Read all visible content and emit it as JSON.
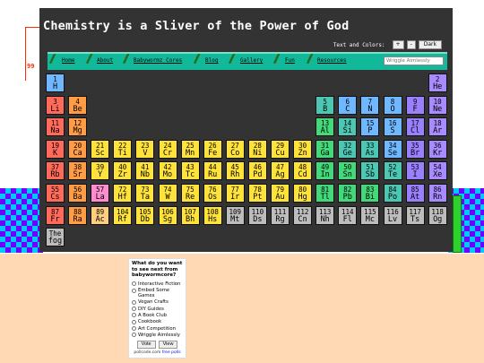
{
  "header": {
    "title": "Chemistry is a Sliver of the Power of God"
  },
  "controls": {
    "label": "Text and Colors:",
    "plus": "+",
    "minus": "-",
    "dark": "Dark"
  },
  "nav": {
    "items": [
      "Home",
      "About",
      "Babywormz Cores",
      "Blog",
      "Gallery",
      "Fun",
      "Resources"
    ],
    "search_placeholder": "Wriggle Aimlessly"
  },
  "decor": {
    "side_text": "99"
  },
  "colors": {
    "nonmetal": "#6fb7ff",
    "noble": "#a78bff",
    "alkali": "#ff6a5a",
    "alkaline": "#ff9c44",
    "transition": "#ffe23a",
    "post_transition": "#43d87a",
    "metalloid": "#4cc7b3",
    "halogen": "#9a80ff",
    "lanthanide": "#ff8ccf",
    "actinide": "#ffcf7f",
    "unknown": "#bdbdbd"
  },
  "elements": [
    {
      "n": "1",
      "s": "H",
      "c": "nonmetal",
      "r": 0,
      "col": 0
    },
    {
      "n": "2",
      "s": "He",
      "c": "noble",
      "r": 0,
      "col": 17
    },
    {
      "n": "3",
      "s": "Li",
      "c": "alkali",
      "r": 1,
      "col": 0
    },
    {
      "n": "4",
      "s": "Be",
      "c": "alkaline",
      "r": 1,
      "col": 1
    },
    {
      "n": "5",
      "s": "B",
      "c": "metalloid",
      "r": 1,
      "col": 12
    },
    {
      "n": "6",
      "s": "C",
      "c": "nonmetal",
      "r": 1,
      "col": 13
    },
    {
      "n": "7",
      "s": "N",
      "c": "nonmetal",
      "r": 1,
      "col": 14
    },
    {
      "n": "8",
      "s": "O",
      "c": "nonmetal",
      "r": 1,
      "col": 15
    },
    {
      "n": "9",
      "s": "F",
      "c": "halogen",
      "r": 1,
      "col": 16
    },
    {
      "n": "10",
      "s": "Ne",
      "c": "noble",
      "r": 1,
      "col": 17
    },
    {
      "n": "11",
      "s": "Na",
      "c": "alkali",
      "r": 2,
      "col": 0
    },
    {
      "n": "12",
      "s": "Mg",
      "c": "alkaline",
      "r": 2,
      "col": 1
    },
    {
      "n": "13",
      "s": "Al",
      "c": "post_transition",
      "r": 2,
      "col": 12
    },
    {
      "n": "14",
      "s": "Si",
      "c": "metalloid",
      "r": 2,
      "col": 13
    },
    {
      "n": "15",
      "s": "P",
      "c": "nonmetal",
      "r": 2,
      "col": 14
    },
    {
      "n": "16",
      "s": "S",
      "c": "nonmetal",
      "r": 2,
      "col": 15
    },
    {
      "n": "17",
      "s": "Cl",
      "c": "halogen",
      "r": 2,
      "col": 16
    },
    {
      "n": "18",
      "s": "Ar",
      "c": "noble",
      "r": 2,
      "col": 17
    },
    {
      "n": "19",
      "s": "K",
      "c": "alkali",
      "r": 3,
      "col": 0
    },
    {
      "n": "20",
      "s": "Ca",
      "c": "alkaline",
      "r": 3,
      "col": 1
    },
    {
      "n": "21",
      "s": "Sc",
      "c": "transition",
      "r": 3,
      "col": 2
    },
    {
      "n": "22",
      "s": "Ti",
      "c": "transition",
      "r": 3,
      "col": 3
    },
    {
      "n": "23",
      "s": "V",
      "c": "transition",
      "r": 3,
      "col": 4
    },
    {
      "n": "24",
      "s": "Cr",
      "c": "transition",
      "r": 3,
      "col": 5
    },
    {
      "n": "25",
      "s": "Mn",
      "c": "transition",
      "r": 3,
      "col": 6
    },
    {
      "n": "26",
      "s": "Fe",
      "c": "transition",
      "r": 3,
      "col": 7
    },
    {
      "n": "27",
      "s": "Co",
      "c": "transition",
      "r": 3,
      "col": 8
    },
    {
      "n": "28",
      "s": "Ni",
      "c": "transition",
      "r": 3,
      "col": 9
    },
    {
      "n": "29",
      "s": "Cu",
      "c": "transition",
      "r": 3,
      "col": 10
    },
    {
      "n": "30",
      "s": "Zn",
      "c": "transition",
      "r": 3,
      "col": 11
    },
    {
      "n": "31",
      "s": "Ga",
      "c": "post_transition",
      "r": 3,
      "col": 12
    },
    {
      "n": "32",
      "s": "Ge",
      "c": "metalloid",
      "r": 3,
      "col": 13
    },
    {
      "n": "33",
      "s": "As",
      "c": "metalloid",
      "r": 3,
      "col": 14
    },
    {
      "n": "34",
      "s": "Se",
      "c": "nonmetal",
      "r": 3,
      "col": 15
    },
    {
      "n": "35",
      "s": "Br",
      "c": "halogen",
      "r": 3,
      "col": 16
    },
    {
      "n": "36",
      "s": "Kr",
      "c": "noble",
      "r": 3,
      "col": 17
    },
    {
      "n": "37",
      "s": "Rb",
      "c": "alkali",
      "r": 4,
      "col": 0
    },
    {
      "n": "38",
      "s": "Sr",
      "c": "alkaline",
      "r": 4,
      "col": 1
    },
    {
      "n": "39",
      "s": "Y",
      "c": "transition",
      "r": 4,
      "col": 2
    },
    {
      "n": "40",
      "s": "Zr",
      "c": "transition",
      "r": 4,
      "col": 3
    },
    {
      "n": "41",
      "s": "Nb",
      "c": "transition",
      "r": 4,
      "col": 4
    },
    {
      "n": "42",
      "s": "Mo",
      "c": "transition",
      "r": 4,
      "col": 5
    },
    {
      "n": "43",
      "s": "Tc",
      "c": "transition",
      "r": 4,
      "col": 6
    },
    {
      "n": "44",
      "s": "Ru",
      "c": "transition",
      "r": 4,
      "col": 7
    },
    {
      "n": "45",
      "s": "Rh",
      "c": "transition",
      "r": 4,
      "col": 8
    },
    {
      "n": "46",
      "s": "Pd",
      "c": "transition",
      "r": 4,
      "col": 9
    },
    {
      "n": "47",
      "s": "Ag",
      "c": "transition",
      "r": 4,
      "col": 10
    },
    {
      "n": "48",
      "s": "Cd",
      "c": "transition",
      "r": 4,
      "col": 11
    },
    {
      "n": "49",
      "s": "In",
      "c": "post_transition",
      "r": 4,
      "col": 12
    },
    {
      "n": "50",
      "s": "Sn",
      "c": "post_transition",
      "r": 4,
      "col": 13
    },
    {
      "n": "51",
      "s": "Sb",
      "c": "metalloid",
      "r": 4,
      "col": 14
    },
    {
      "n": "52",
      "s": "Te",
      "c": "metalloid",
      "r": 4,
      "col": 15
    },
    {
      "n": "53",
      "s": "I",
      "c": "halogen",
      "r": 4,
      "col": 16
    },
    {
      "n": "54",
      "s": "Xe",
      "c": "noble",
      "r": 4,
      "col": 17
    },
    {
      "n": "55",
      "s": "Cs",
      "c": "alkali",
      "r": 5,
      "col": 0
    },
    {
      "n": "56",
      "s": "Ba",
      "c": "alkaline",
      "r": 5,
      "col": 1
    },
    {
      "n": "57",
      "s": "La",
      "c": "lanthanide",
      "r": 5,
      "col": 2
    },
    {
      "n": "72",
      "s": "Hf",
      "c": "transition",
      "r": 5,
      "col": 3
    },
    {
      "n": "73",
      "s": "Ta",
      "c": "transition",
      "r": 5,
      "col": 4
    },
    {
      "n": "74",
      "s": "W",
      "c": "transition",
      "r": 5,
      "col": 5
    },
    {
      "n": "75",
      "s": "Re",
      "c": "transition",
      "r": 5,
      "col": 6
    },
    {
      "n": "76",
      "s": "Os",
      "c": "transition",
      "r": 5,
      "col": 7
    },
    {
      "n": "77",
      "s": "Ir",
      "c": "transition",
      "r": 5,
      "col": 8
    },
    {
      "n": "78",
      "s": "Pt",
      "c": "transition",
      "r": 5,
      "col": 9
    },
    {
      "n": "79",
      "s": "Au",
      "c": "transition",
      "r": 5,
      "col": 10
    },
    {
      "n": "80",
      "s": "Hg",
      "c": "transition",
      "r": 5,
      "col": 11
    },
    {
      "n": "81",
      "s": "Tl",
      "c": "post_transition",
      "r": 5,
      "col": 12
    },
    {
      "n": "82",
      "s": "Pb",
      "c": "post_transition",
      "r": 5,
      "col": 13
    },
    {
      "n": "83",
      "s": "Bi",
      "c": "post_transition",
      "r": 5,
      "col": 14
    },
    {
      "n": "84",
      "s": "Po",
      "c": "metalloid",
      "r": 5,
      "col": 15
    },
    {
      "n": "85",
      "s": "At",
      "c": "halogen",
      "r": 5,
      "col": 16
    },
    {
      "n": "86",
      "s": "Rn",
      "c": "noble",
      "r": 5,
      "col": 17
    },
    {
      "n": "87",
      "s": "Fr",
      "c": "alkali",
      "r": 6,
      "col": 0
    },
    {
      "n": "88",
      "s": "Ra",
      "c": "alkaline",
      "r": 6,
      "col": 1
    },
    {
      "n": "89",
      "s": "Ac",
      "c": "actinide",
      "r": 6,
      "col": 2
    },
    {
      "n": "104",
      "s": "Rf",
      "c": "transition",
      "r": 6,
      "col": 3
    },
    {
      "n": "105",
      "s": "Db",
      "c": "transition",
      "r": 6,
      "col": 4
    },
    {
      "n": "106",
      "s": "Sg",
      "c": "transition",
      "r": 6,
      "col": 5
    },
    {
      "n": "107",
      "s": "Bh",
      "c": "transition",
      "r": 6,
      "col": 6
    },
    {
      "n": "108",
      "s": "Hs",
      "c": "transition",
      "r": 6,
      "col": 7
    },
    {
      "n": "109",
      "s": "Mt",
      "c": "unknown",
      "r": 6,
      "col": 8
    },
    {
      "n": "110",
      "s": "Ds",
      "c": "unknown",
      "r": 6,
      "col": 9
    },
    {
      "n": "111",
      "s": "Rg",
      "c": "unknown",
      "r": 6,
      "col": 10
    },
    {
      "n": "112",
      "s": "Cn",
      "c": "unknown",
      "r": 6,
      "col": 11
    },
    {
      "n": "113",
      "s": "Nh",
      "c": "unknown",
      "r": 6,
      "col": 12
    },
    {
      "n": "114",
      "s": "Fl",
      "c": "unknown",
      "r": 6,
      "col": 13
    },
    {
      "n": "115",
      "s": "Mc",
      "c": "unknown",
      "r": 6,
      "col": 14
    },
    {
      "n": "116",
      "s": "Lv",
      "c": "unknown",
      "r": 6,
      "col": 15
    },
    {
      "n": "117",
      "s": "Ts",
      "c": "unknown",
      "r": 6,
      "col": 16
    },
    {
      "n": "118",
      "s": "Og",
      "c": "unknown",
      "r": 6,
      "col": 17
    },
    {
      "n": "The",
      "s": "fog",
      "c": "unknown",
      "r": 7,
      "col": 0
    }
  ],
  "poll": {
    "question": "What do you want to see next from babywormcore?",
    "options": [
      "Interactive Fiction",
      "Embed Some Games",
      "Vegan Crafts",
      "DIY Guides",
      "A Book Club",
      "Cookbook",
      "Art Competition",
      "Wriggle Aimlessly"
    ],
    "vote": "Vote",
    "view": "View",
    "footer_site": "pollcode.com",
    "footer_link": "free polls"
  }
}
